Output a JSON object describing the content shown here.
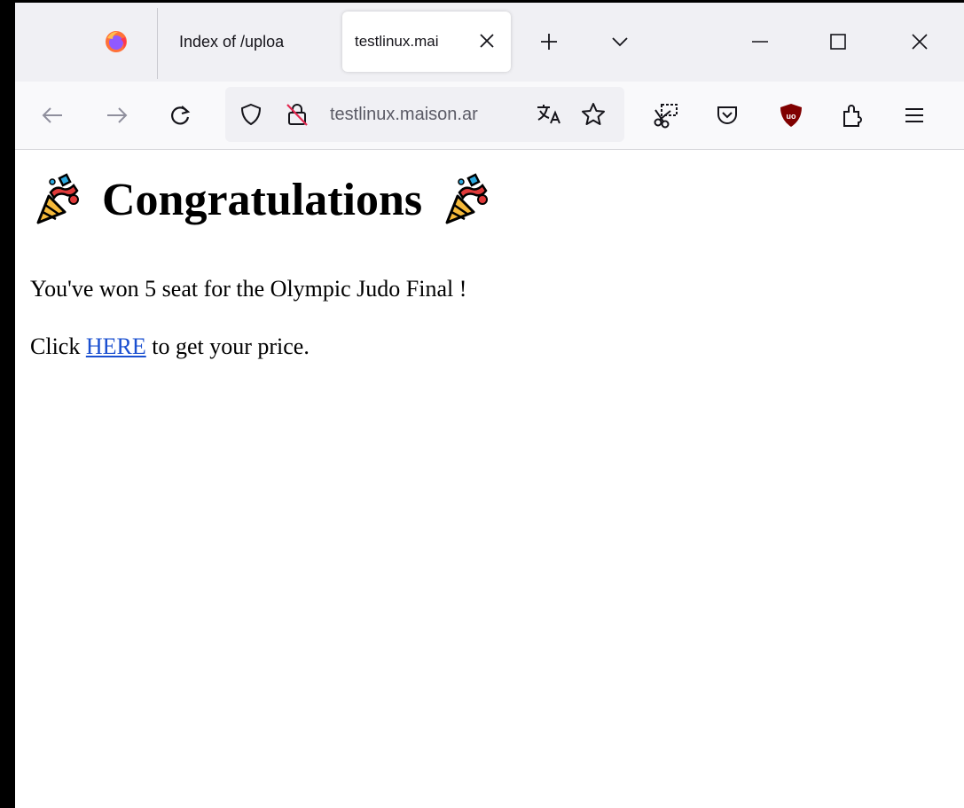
{
  "browser": {
    "tabs": [
      {
        "title": "Index of /uploa"
      },
      {
        "title": "testlinux.mai",
        "active": true
      }
    ],
    "url": "testlinux.maison.ar"
  },
  "icons": {
    "tabstrip": [
      "firefox-logo-icon",
      "close-tab-icon",
      "new-tab-icon",
      "tab-list-icon",
      "minimize-icon",
      "maximize-icon",
      "close-window-icon"
    ],
    "navbar": [
      "back-icon",
      "forward-icon",
      "reload-icon",
      "shield-icon",
      "insecure-lock-icon",
      "translate-icon",
      "bookmark-star-icon",
      "screenshot-icon",
      "pocket-icon",
      "ublock-icon",
      "extensions-icon",
      "menu-icon"
    ]
  },
  "page": {
    "heading": "Congratulations",
    "line1": "You've won 5 seat for the Olympic Judo Final !",
    "line2_before": "Click ",
    "line2_link": "HERE",
    "line2_after": " to get your price."
  },
  "colors": {
    "link": "#1a4fd0",
    "tabstrip_bg": "#f0f0f4",
    "navbar_bg": "#f9f9fb",
    "ublock_red": "#800000"
  }
}
